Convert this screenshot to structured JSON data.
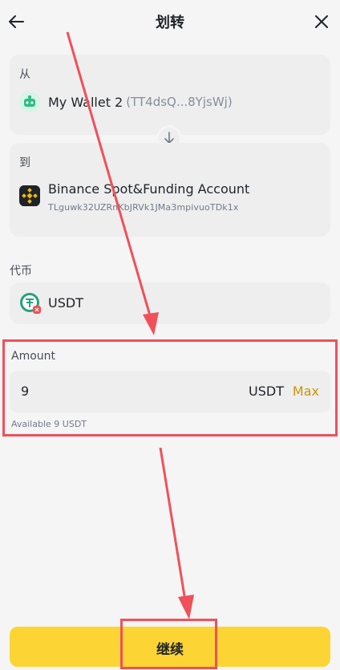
{
  "header": {
    "title": "划转",
    "back_icon": "arrow-left-icon",
    "close_icon": "close-icon"
  },
  "from": {
    "label": "从",
    "wallet_name": "My Wallet 2",
    "wallet_address": "(TT4dsQ...8YjsWj)",
    "icon": "robot-icon",
    "icon_color": "#2dbd85"
  },
  "swap_icon": "arrow-down-icon",
  "to": {
    "label": "到",
    "account_name": "Binance Spot&Funding Account",
    "account_address": "TLguwk32UZRnKbJRVk1JMa3mpivuoTDk1x",
    "icon": "binance-logo-icon"
  },
  "coin": {
    "label": "代币",
    "name": "USDT",
    "icon": "tether-icon",
    "icon_color": "#26a17b"
  },
  "amount": {
    "label": "Amount",
    "value": "9",
    "unit": "USDT",
    "max_label": "Max",
    "available": "Available 9 USDT"
  },
  "continue_label": "继续",
  "colors": {
    "accent_yellow": "#fcd535",
    "max_gold": "#c99400",
    "annotation_red": "#f0505a"
  }
}
